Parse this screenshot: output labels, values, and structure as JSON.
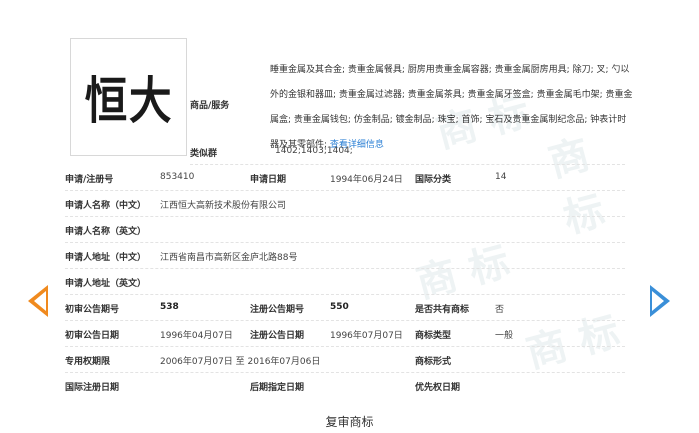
{
  "trademark": {
    "logo_text": "恒大",
    "goods_services_label": "商品/服务",
    "goods_services_text": "睡重金属及其合金; 贵重金属餐具; 厨房用贵重金属容器; 贵重金属厨房用具; 除刀; 叉; 勺以外的金银和器皿; 贵重金属过滤器; 贵重金属茶具; 贵重金属牙签盒; 贵重金属毛巾架; 贵重金属盒; 贵重金属钱包; 仿金制品; 镀金制品; 珠宝; 首饰; 宝石及贵重金属制纪念品; 钟表计时器及其零部件;",
    "detail_link": "查看详细信息",
    "similar_group_label": "类似群",
    "similar_group_value": "1402;1403;1404;"
  },
  "fields": {
    "reg_no_label": "申请/注册号",
    "reg_no_value": "853410",
    "apply_date_label": "申请日期",
    "apply_date_value": "1994年06月24日",
    "intl_class_label": "国际分类",
    "intl_class_value": "14",
    "applicant_cn_label": "申请人名称（中文）",
    "applicant_cn_value": "江西恒大高新技术股份有限公司",
    "applicant_en_label": "申请人名称（英文）",
    "address_cn_label": "申请人地址（中文）",
    "address_cn_value": "江西省南昌市高新区金庐北路88号",
    "address_en_label": "申请人地址（英文）",
    "prelim_issue_label": "初审公告期号",
    "prelim_issue_value": "538",
    "reg_issue_label": "注册公告期号",
    "reg_issue_value": "550",
    "shared_label": "是否共有商标",
    "shared_value": "否",
    "prelim_date_label": "初审公告日期",
    "prelim_date_value": "1996年04月07日",
    "reg_date_label": "注册公告日期",
    "reg_date_value": "1996年07月07日",
    "mark_type_label": "商标类型",
    "mark_type_value": "一般",
    "exclusive_label": "专用权期限",
    "exclusive_value": "2006年07月07日 至 2016年07月06日",
    "mark_form_label": "商标形式",
    "intl_reg_date_label": "国际注册日期",
    "later_date_label": "后期指定日期",
    "priority_date_label": "优先权日期"
  },
  "nav": {
    "prev_icon": "arrow-left-icon",
    "next_icon": "arrow-right-icon",
    "prev_color": "#f08a1e",
    "next_color": "#3a8fd8"
  },
  "caption": "复审商标"
}
